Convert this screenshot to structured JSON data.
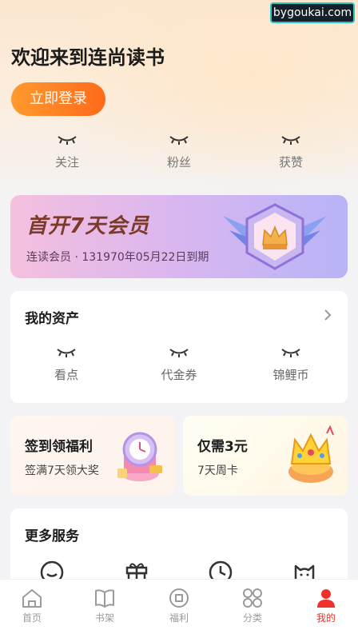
{
  "watermark": "bygoukai.com",
  "header": {
    "welcome": "欢迎来到连尚读书",
    "login_label": "立即登录"
  },
  "stats": [
    {
      "label": "关注",
      "icon": "hidden-eye-icon"
    },
    {
      "label": "粉丝",
      "icon": "hidden-eye-icon"
    },
    {
      "label": "获赞",
      "icon": "hidden-eye-icon"
    }
  ],
  "vip": {
    "title": "首开7天会员",
    "subtitle": "连读会员 · 131970年05月22日到期",
    "title_color": "#7b3a2a"
  },
  "assets": {
    "title": "我的资产",
    "items": [
      {
        "label": "看点",
        "icon": "hidden-eye-icon"
      },
      {
        "label": "代金券",
        "icon": "hidden-eye-icon"
      },
      {
        "label": "锦鲤币",
        "icon": "hidden-eye-icon"
      }
    ]
  },
  "promos": [
    {
      "title": "签到领福利",
      "subtitle": "签满7天领大奖",
      "icon": "gift-clock-icon"
    },
    {
      "title": "仅需3元",
      "subtitle": "7天周卡",
      "icon": "crown-treasure-icon"
    }
  ],
  "services": {
    "title": "更多服务",
    "icons": [
      "chat-icon",
      "gift-box-icon",
      "clock-icon",
      "cat-face-icon"
    ]
  },
  "tabbar": {
    "active_color": "#f0302a",
    "items": [
      {
        "label": "首页",
        "icon": "home-icon",
        "active": false
      },
      {
        "label": "书架",
        "icon": "book-icon",
        "active": false
      },
      {
        "label": "福利",
        "icon": "coin-icon",
        "active": false
      },
      {
        "label": "分类",
        "icon": "grid-icon",
        "active": false
      },
      {
        "label": "我的",
        "icon": "user-icon",
        "active": true
      }
    ]
  }
}
